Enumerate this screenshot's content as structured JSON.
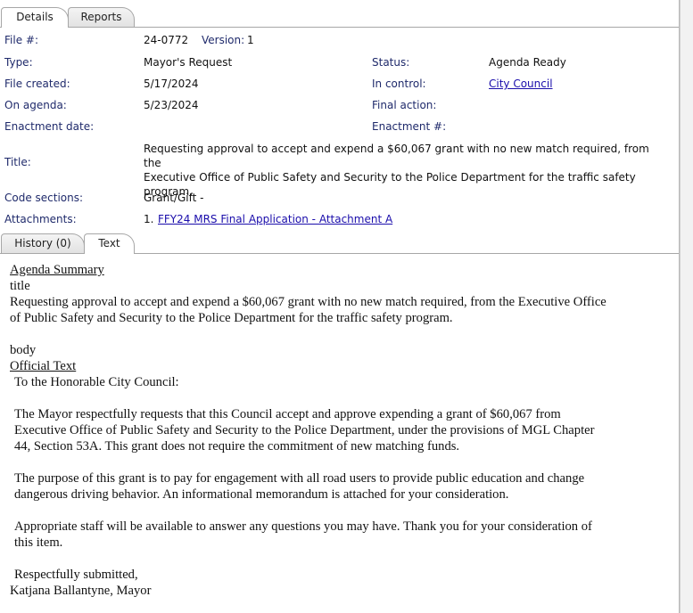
{
  "top_tabs": [
    {
      "label": "Details",
      "active": true
    },
    {
      "label": "Reports",
      "active": false
    }
  ],
  "details": {
    "file_no_label": "File #:",
    "file_no": "24-0772",
    "version_label": "Version:",
    "version": "1",
    "type_label": "Type:",
    "type": "Mayor's Request",
    "status_label": "Status:",
    "status": "Agenda Ready",
    "file_created_label": "File created:",
    "file_created": "5/17/2024",
    "in_control_label": "In control:",
    "in_control": "City Council",
    "on_agenda_label": "On agenda:",
    "on_agenda": "5/23/2024",
    "final_action_label": "Final action:",
    "final_action": "",
    "enactment_date_label": "Enactment date:",
    "enactment_date": "",
    "enactment_no_label": "Enactment #:",
    "enactment_no": "",
    "title_label": "Title:",
    "title_line1": "Requesting approval to accept and expend a $60,067 grant with no new match required, from the",
    "title_line2": "Executive Office of Public Safety and Security to the Police Department for the traffic safety",
    "title_line3": "program.",
    "code_sections_label": "Code sections:",
    "code_sections": "Grant/Gift -",
    "attachments_label": "Attachments:",
    "attachment_index": "1.",
    "attachment_link": "FFY24 MRS Final Application - Attachment A"
  },
  "bottom_tabs": [
    {
      "label": "History (0)",
      "active": false
    },
    {
      "label": "Text",
      "active": true
    }
  ],
  "text": {
    "heading": "Agenda Summary",
    "title_word": "title",
    "summary_line1": "Requesting approval to accept and expend a $60,067 grant with no new match required, from the Executive Office",
    "summary_line2": "of Public Safety and Security to the Police Department for the traffic safety program.",
    "body_word": "body",
    "official_heading": "Official Text",
    "salutation": "To the Honorable City Council:",
    "para1_line1": "The Mayor respectfully requests that this Council accept and approve expending a grant of $60,067 from",
    "para1_line2": "Executive Office of Public Safety and Security to the Police Department, under the provisions of MGL Chapter",
    "para1_line3": "44, Section 53A. This grant does not require the commitment of new matching funds.",
    "para2_line1": "The purpose of this grant is to pay for engagement with all road users to provide public education and change",
    "para2_line2": "dangerous driving behavior. An informational memorandum is attached for your consideration.",
    "para3_line1": "Appropriate staff will be available to answer any questions you may have. Thank you for your consideration of",
    "para3_line2": "this item.",
    "closing": "Respectfully submitted,",
    "signature": "Katjana Ballantyne, Mayor"
  }
}
